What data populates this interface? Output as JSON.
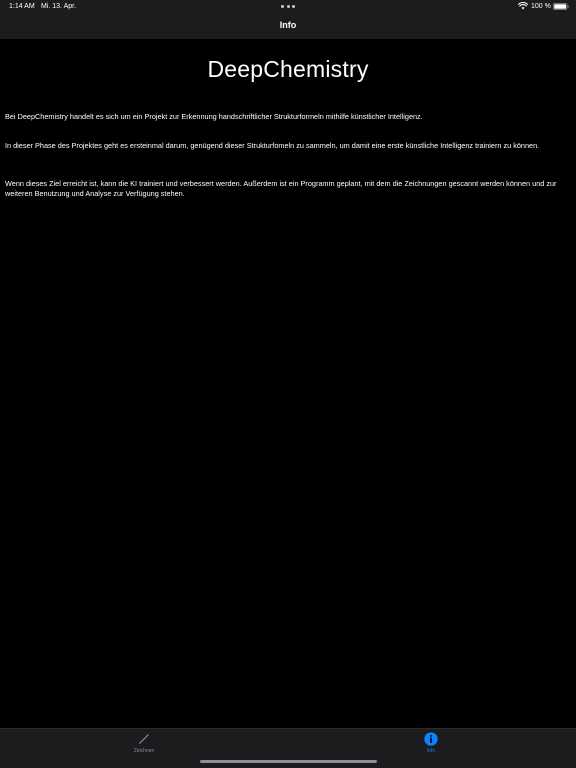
{
  "status_bar": {
    "time": "1:14 AM",
    "date": "Mi. 13. Apr.",
    "battery": "100 %"
  },
  "nav": {
    "title": "Info"
  },
  "main": {
    "app_title": "DeepChemistry",
    "paragraphs": [
      "Bei DeepChemistry handelt es sich um ein Projekt zur Erkennung handschriftlicher Strukturformeln mithilfe künstlicher Intelligenz.",
      "In dieser Phase des Projektes geht es ersteinmal darum, genügend dieser Strukturfomeln zu sammeln, um damit eine erste künstliche Intelligenz trainiern zu können.",
      "Wenn dieses Ziel erreicht ist, kann die KI trainiert und verbessert werden. Außerdem ist ein Programm geplant, mit dem die Zeichnungen gescannt werden können und zur weiteren Benutzung und Analyse zur Verfügung stehen."
    ]
  },
  "tab_bar": {
    "tabs": [
      {
        "label": "Zeichnen",
        "icon": "pencil-icon",
        "selected": false
      },
      {
        "label": "Info",
        "icon": "info-icon",
        "selected": true
      }
    ],
    "active_color": "#0a84ff",
    "inactive_color": "#8e8e93"
  },
  "colors": {
    "background": "#000000",
    "bar_background": "#1c1c1e",
    "text": "#ffffff"
  }
}
